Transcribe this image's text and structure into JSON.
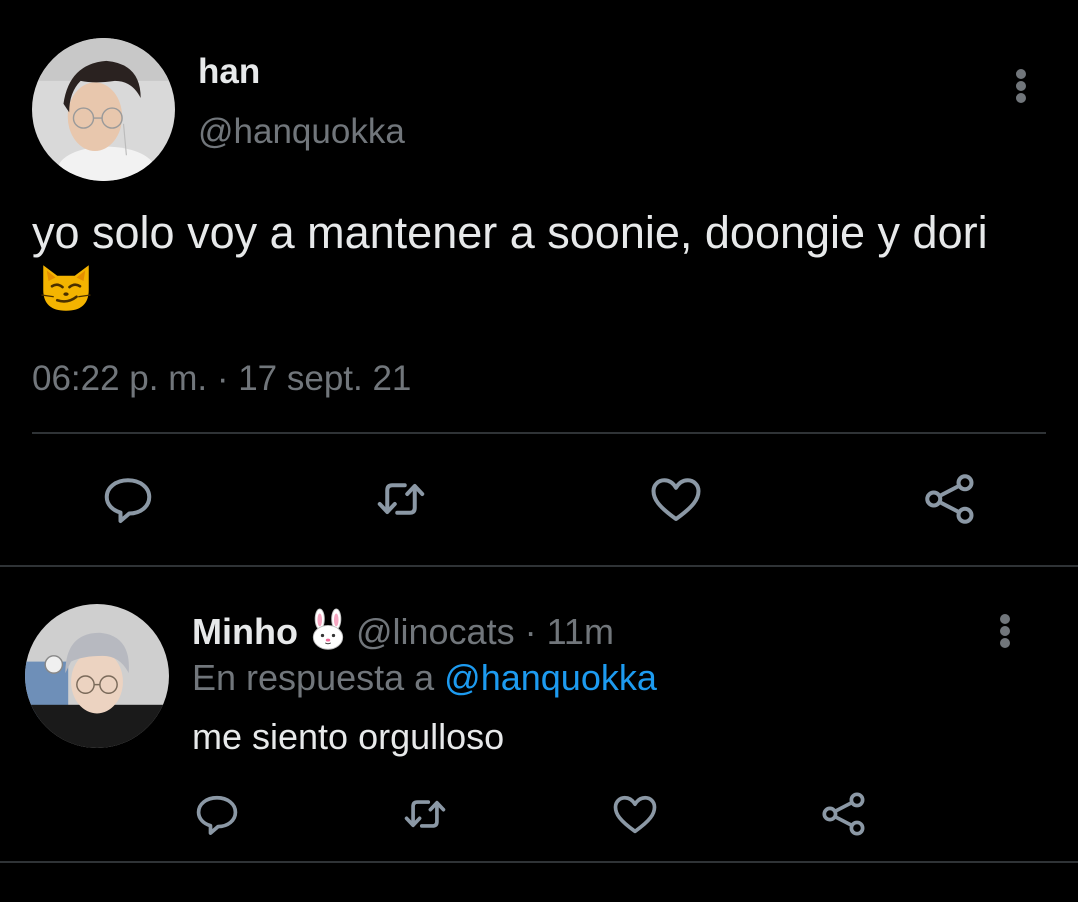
{
  "tweet": {
    "display_name": "han",
    "handle": "@hanquokka",
    "text": "yo solo voy a mantener a soonie, doongie y dori",
    "emoji": "smirking-cat-emoji",
    "timestamp": "06:22 p. m. · 17 sept. 21",
    "actions": [
      "reply-icon",
      "retweet-icon",
      "like-icon",
      "share-icon"
    ]
  },
  "reply": {
    "display_name": "Minho",
    "name_emoji": "rabbit-face-emoji",
    "handle": "@linocats",
    "separator": " · ",
    "time": "11m",
    "replying_prefix": "En respuesta a ",
    "replying_to": "@hanquokka",
    "text": "me siento orgulloso",
    "actions": [
      "reply-icon",
      "retweet-icon",
      "like-icon",
      "share-icon"
    ]
  },
  "colors": {
    "background": "#000000",
    "primary_text": "#e7e9ea",
    "secondary_text": "#71767b",
    "link": "#1d9bf0",
    "divider": "#2f3336"
  }
}
